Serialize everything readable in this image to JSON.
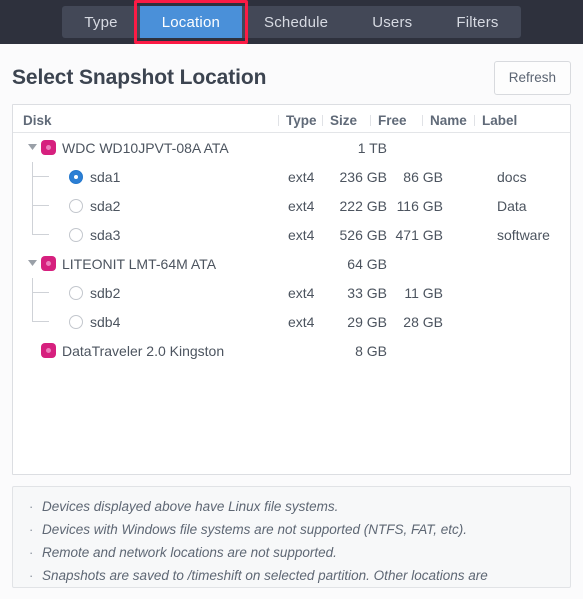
{
  "tabs": [
    {
      "label": "Type",
      "active": false
    },
    {
      "label": "Location",
      "active": true
    },
    {
      "label": "Schedule",
      "active": false
    },
    {
      "label": "Users",
      "active": false
    },
    {
      "label": "Filters",
      "active": false
    }
  ],
  "annotation": {
    "color": "#fb1b45",
    "target": "Location"
  },
  "header": {
    "title": "Select Snapshot Location",
    "refresh_label": "Refresh"
  },
  "table": {
    "columns": [
      "Disk",
      "Type",
      "Size",
      "Free",
      "Name",
      "Label"
    ],
    "rows": [
      {
        "kind": "disk",
        "name": "WDC WD10JPVT-08A ATA",
        "size": "1 TB",
        "expanded": true,
        "icon": "disk-icon",
        "twisty": "chevron-down-icon"
      },
      {
        "kind": "partition",
        "name": "sda1",
        "type": "ext4",
        "size": "236 GB",
        "free": "86 GB",
        "disk_name": "",
        "label": "docs",
        "selected": true,
        "last": false
      },
      {
        "kind": "partition",
        "name": "sda2",
        "type": "ext4",
        "size": "222 GB",
        "free": "116 GB",
        "disk_name": "",
        "label": "Data",
        "selected": false,
        "last": false
      },
      {
        "kind": "partition",
        "name": "sda3",
        "type": "ext4",
        "size": "526 GB",
        "free": "471 GB",
        "disk_name": "",
        "label": "software",
        "selected": false,
        "last": true
      },
      {
        "kind": "disk",
        "name": "LITEONIT LMT-64M ATA",
        "size": "64 GB",
        "expanded": true,
        "icon": "disk-icon",
        "twisty": "chevron-down-icon"
      },
      {
        "kind": "partition",
        "name": "sdb2",
        "type": "ext4",
        "size": "33 GB",
        "free": "11 GB",
        "disk_name": "",
        "label": "",
        "selected": false,
        "last": false
      },
      {
        "kind": "partition",
        "name": "sdb4",
        "type": "ext4",
        "size": "29 GB",
        "free": "28 GB",
        "disk_name": "",
        "label": "",
        "selected": false,
        "last": true
      },
      {
        "kind": "disk",
        "name": "DataTraveler 2.0 Kingston",
        "size": "8 GB",
        "expanded": false,
        "icon": "disk-icon",
        "twisty": "none"
      }
    ]
  },
  "notes": {
    "bullet": "·",
    "items": [
      "Devices displayed above have Linux file systems.",
      "Devices with Windows file systems are not supported (NTFS, FAT, etc).",
      "Remote and network locations are not supported.",
      "Snapshots are saved to /timeshift on selected partition. Other locations are"
    ]
  },
  "colors": {
    "tabbar_bg": "#2e313d",
    "tabstrip_bg": "#434857",
    "active_tab": "#4a90d9",
    "annotation": "#fb1b45",
    "disk_icon": "#d6207e",
    "radio_selected": "#2c7fd4"
  }
}
